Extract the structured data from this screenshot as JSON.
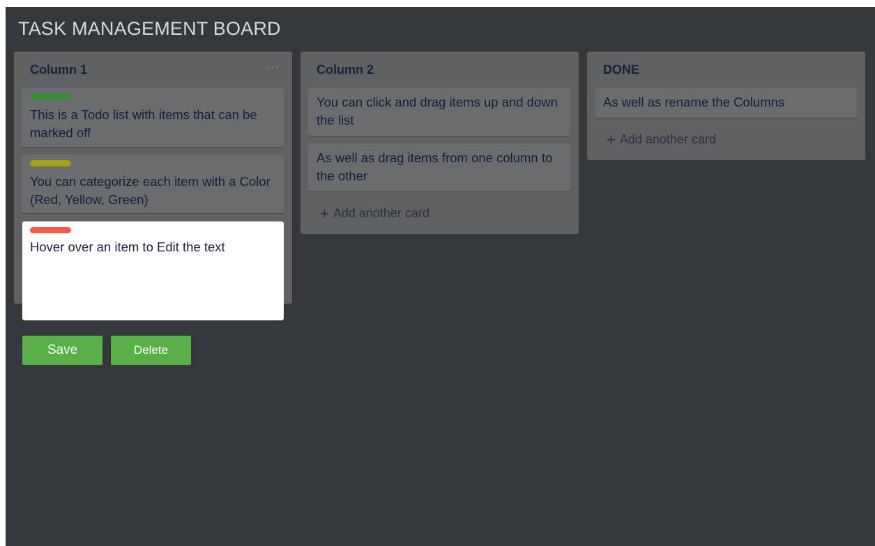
{
  "board": {
    "title": "TASK MANAGEMENT BOARD"
  },
  "columns": [
    {
      "title": "Column 1",
      "menu": "···",
      "cards": [
        {
          "label_color": "green",
          "text": "This is a Todo list with items that can be marked off"
        },
        {
          "label_color": "yellow",
          "text": "You can categorize each item with a Color (Red, Yellow, Green)"
        }
      ]
    },
    {
      "title": "Column 2",
      "cards": [
        {
          "text": "You can click and drag items up and down the list"
        },
        {
          "text": "As well as drag items from one column to the other"
        }
      ],
      "add_card": "Add another card"
    },
    {
      "title": "DONE",
      "cards": [
        {
          "text": "As well as rename the Columns"
        }
      ],
      "add_card": "Add another card"
    }
  ],
  "editor": {
    "label_color": "red",
    "text": "Hover over an item to Edit the text",
    "save_label": "Save",
    "delete_label": "Delete"
  },
  "icons": {
    "add": "plus-icon",
    "menu": "more-horizontal-icon"
  },
  "colors": {
    "background": "#35383b",
    "column": "#606163",
    "card": "#6b6c6e",
    "label_green": "#3a8a3a",
    "label_yellow": "#a6a110",
    "label_red": "#ee5a46",
    "button": "#5aaf47"
  }
}
